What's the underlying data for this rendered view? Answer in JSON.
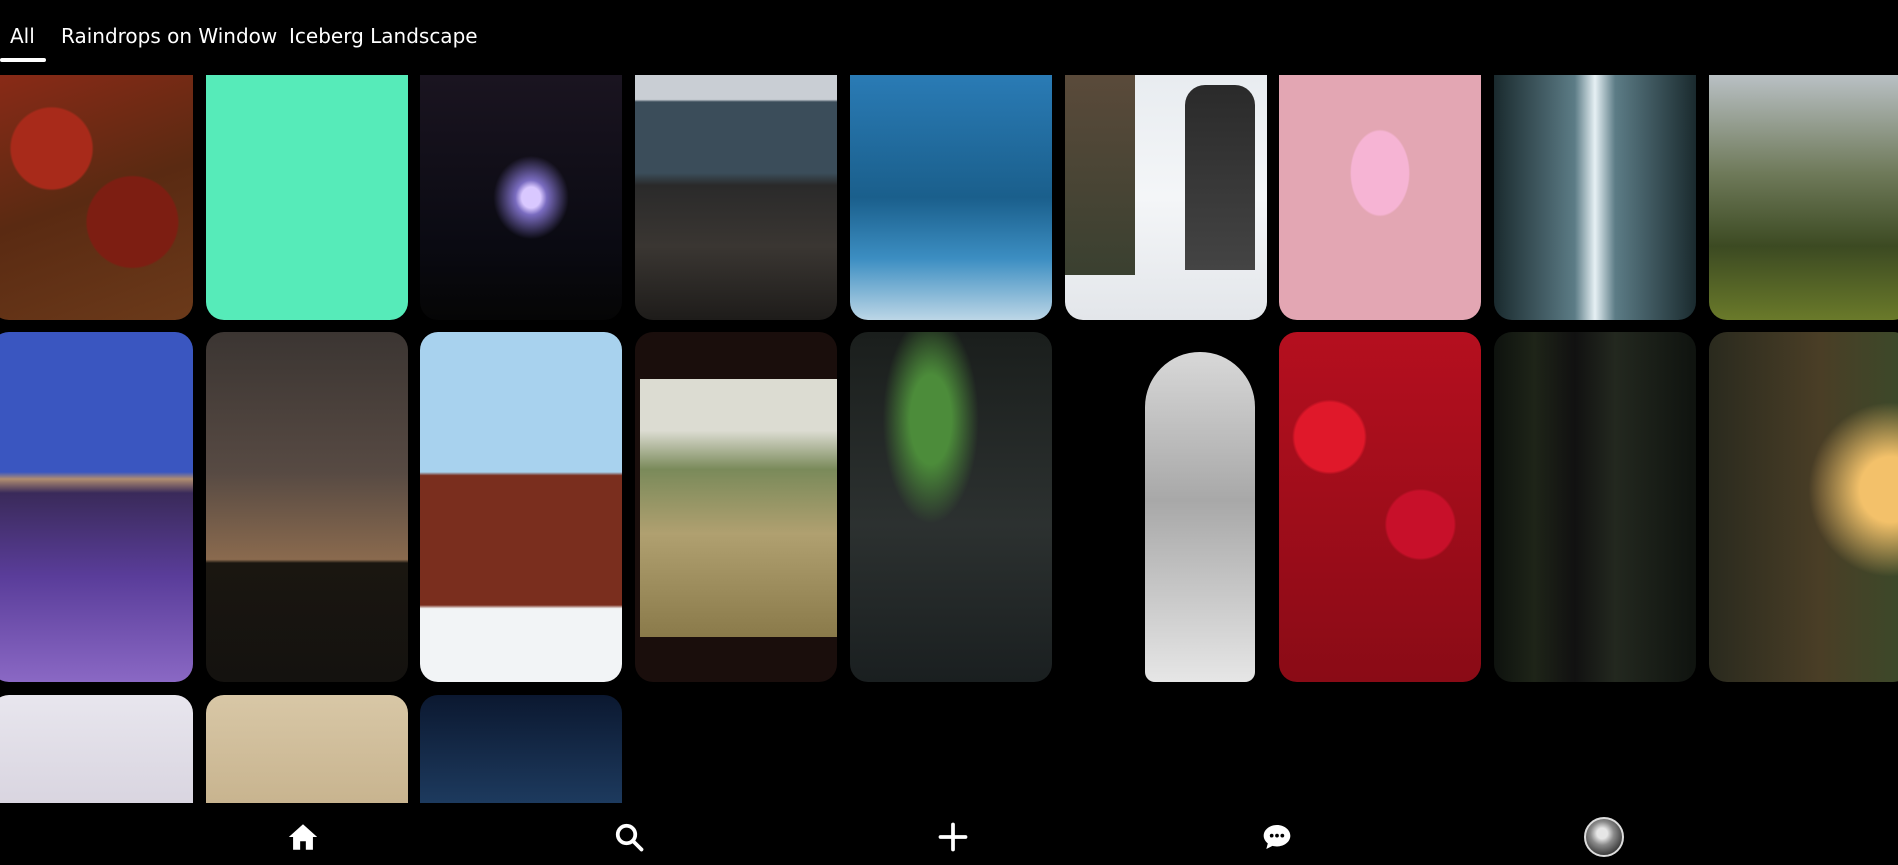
{
  "tabs": [
    {
      "label": "All",
      "active": true
    },
    {
      "label": "Raindrops on Window",
      "active": false
    },
    {
      "label": "Iceberg Landscape",
      "active": false
    }
  ],
  "grid": {
    "rows": [
      [
        "red-ivy-window",
        "mint-green-tile",
        "lit-christmas-tree",
        "rocky-shore-person",
        "watercolor-sea-man",
        "snow-drink-pour",
        "pink-abstract-ring",
        "icy-waterfall",
        "mountain-valley"
      ],
      [
        "lavender-field",
        "desert-dusk-silhouette",
        "red-barn-winter",
        "vintage-film-frame",
        "aurora-night",
        "white-costume-headdress",
        "red-shrub-field",
        "dark-forest-hiker",
        "sunlit-forest"
      ],
      [
        "white-studio",
        "plant-pots-hands",
        "night-sky"
      ]
    ]
  },
  "bottom_nav": [
    {
      "icon": "home-icon"
    },
    {
      "icon": "search-icon"
    },
    {
      "icon": "plus-icon"
    },
    {
      "icon": "chat-icon"
    },
    {
      "icon": "avatar"
    }
  ],
  "colors": {
    "background": "#000000",
    "text": "#ffffff",
    "mint_tile": "#56ebb9"
  }
}
